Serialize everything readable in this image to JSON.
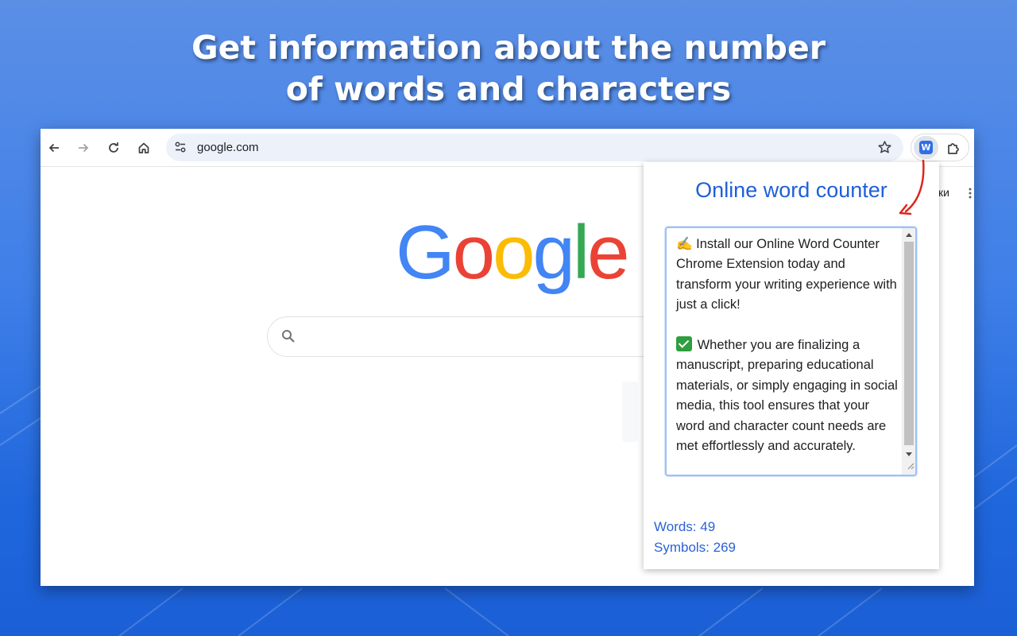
{
  "headline": {
    "line1": "Get information about the number",
    "line2": "of words and characters"
  },
  "browser": {
    "url": "google.com",
    "toolbar_icons": [
      "back-icon",
      "forward-icon",
      "reload-icon",
      "home-icon",
      "site-settings-icon",
      "bookmark-star-icon",
      "extension-w-icon",
      "extensions-puzzle-icon"
    ],
    "extension_badge": "W"
  },
  "google_page": {
    "logo_letters": [
      "G",
      "o",
      "o",
      "g",
      "l",
      "e"
    ],
    "logo_colors": [
      "#4285F4",
      "#EA4335",
      "#FBBC05",
      "#4285F4",
      "#34A853",
      "#EA4335"
    ],
    "partial_text": "ки"
  },
  "popup": {
    "title": "Online word counter",
    "paragraph1": "✍️ Install our Online Word Counter Chrome Extension today and transform your writing experience with just a click!",
    "paragraph2": "Whether you are finalizing a manuscript, preparing educational materials, or simply engaging in social media, this tool ensures that your word and character count needs are met effortlessly and accurately.",
    "words_label": "Words: 49",
    "symbols_label": "Symbols: 269"
  },
  "colors": {
    "accent_blue": "#1f5fd9",
    "stats_blue": "#2a62d8",
    "arrow_red": "#e0241f",
    "background": "#3f7fe8"
  }
}
